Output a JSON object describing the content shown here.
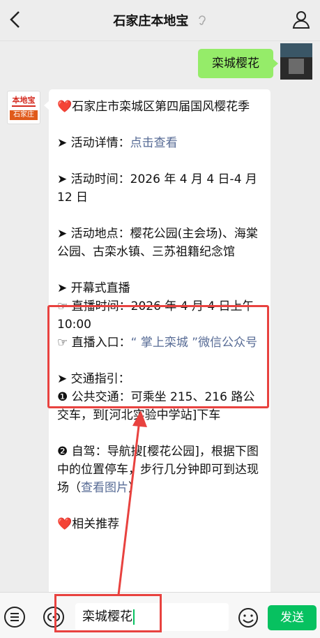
{
  "header": {
    "title": "石家庄本地宝",
    "back_icon": "chevron-left-icon",
    "ear_icon": "ear-icon",
    "profile_icon": "person-icon"
  },
  "outgoing": {
    "text": "栾城樱花"
  },
  "incoming": {
    "avatar_top": "本地宝",
    "avatar_bottom": "石家庄",
    "title_heart": "❤️",
    "title": "石家庄市栾城区第四届国风樱花季",
    "details_prefix": "➤ 活动详情：",
    "details_link": "点击查看",
    "time": "➤ 活动时间：2026 年 4 月 4 日-4 月 12 日",
    "location": "➤ 活动地点：樱花公园(主会场)、海棠公园、古栾水镇、三苏祖籍纪念馆",
    "live_title": "➤ 开幕式直播",
    "live_time": "☞ 直播时间：2026 年 4 月 4 日上午 10:00",
    "live_entry_prefix": "☞ 直播入口：",
    "live_entry_link": "“ 掌上栾城 ”微信公众号",
    "traffic_title": "➤ 交通指引：",
    "traffic_public": "❶ 公共交通：可乘坐 215、216 路公交车，到[河北实验中学站]下车",
    "traffic_drive_prefix": "❷ 自驾：导航搜[樱花公园]，根据下图中的位置停车，步行几分钟即可到达现场（",
    "traffic_drive_link": "查看图片",
    "traffic_drive_suffix": "）",
    "related_heart": "❤️",
    "related": "相关推荐"
  },
  "inputbar": {
    "voice_icon": "voice-icon",
    "keyboard_icon": "keyboard-icon",
    "input_value": "栾城樱花",
    "emoji_icon": "emoji-icon",
    "send_label": "发送"
  },
  "colors": {
    "send_green": "#07c160",
    "bubble_green": "#95ec69",
    "annotation_red": "#e8423f",
    "link_blue": "#576b95"
  }
}
